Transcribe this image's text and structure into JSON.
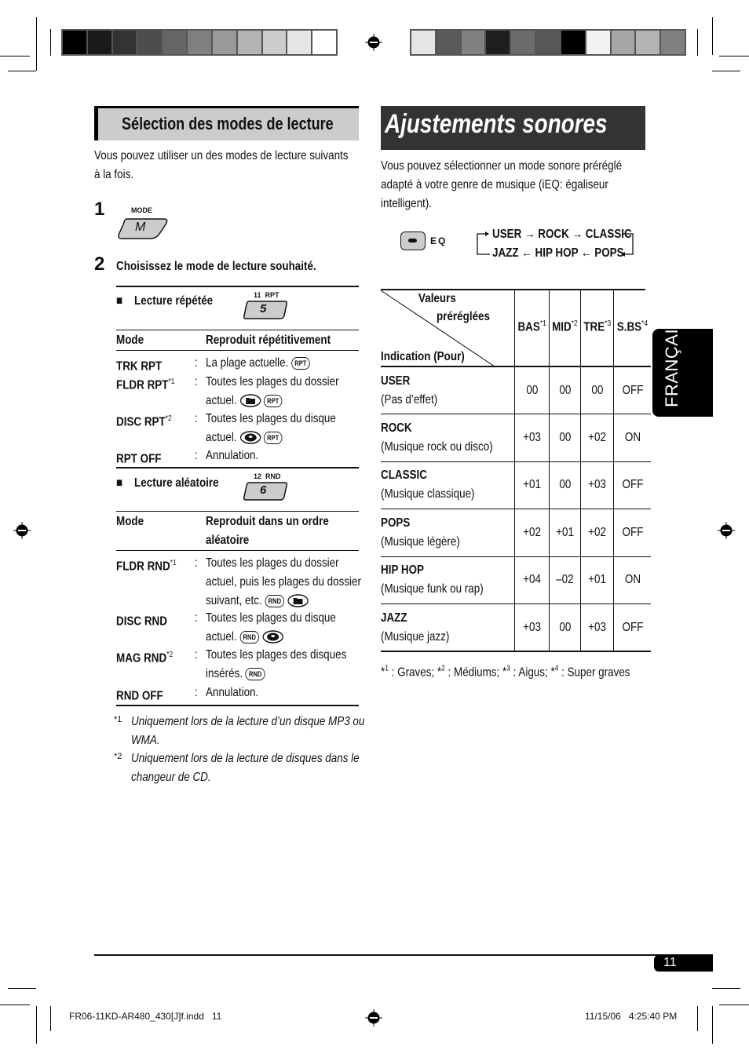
{
  "print_marks": {
    "color_bar_left": [
      "#000000",
      "#1a1a1a",
      "#333333",
      "#4d4d4d",
      "#666666",
      "#808080",
      "#999999",
      "#b3b3b3",
      "#cccccc",
      "#e6e6e6",
      "#ffffff"
    ],
    "color_bar_right": [
      "#e6e6e6",
      "#5a5a5a",
      "#808080",
      "#1e1e1e",
      "#6b6b6b",
      "#575757",
      "#000000",
      "#f2f2f2",
      "#a6a6a6",
      "#b3b3b3",
      "#808080"
    ]
  },
  "left": {
    "heading": "Sélection des modes de lecture",
    "intro_line1": "Vous pouvez utiliser un des modes de lecture suivants",
    "intro_line2": "à la fois.",
    "step1": {
      "number": "1",
      "button_caption": "MODE",
      "button_label": "M"
    },
    "step2": {
      "number": "2",
      "text": "Choisissez le mode de lecture souhaité."
    },
    "repeat": {
      "bullet": "■",
      "title": "Lecture répétée",
      "button_caption": "11  RPT",
      "button_label": "5",
      "col_mode": "Mode",
      "col_desc": "Reproduit répétitivement",
      "rows": [
        {
          "mode": "TRK RPT",
          "note": "",
          "line1": "La plage actuelle.",
          "line2": "",
          "icons": [
            "RPT"
          ]
        },
        {
          "mode": "FLDR RPT",
          "note": "*1",
          "line1": "Toutes les plages du dossier",
          "line2": "actuel.",
          "icons": [
            "folder",
            "RPT"
          ]
        },
        {
          "mode": "DISC RPT",
          "note": "*2",
          "line1": "Toutes les plages du disque",
          "line2": "actuel.",
          "icons": [
            "disc",
            "RPT"
          ]
        },
        {
          "mode": "RPT OFF",
          "note": "",
          "line1": "Annulation.",
          "line2": "",
          "icons": []
        }
      ]
    },
    "random": {
      "bullet": "■",
      "title": "Lecture aléatoire",
      "button_caption": "12  RND",
      "button_label": "6",
      "col_mode": "Mode",
      "col_desc_line1": "Reproduit dans un ordre",
      "col_desc_line2": "aléatoire",
      "rows": [
        {
          "mode": "FLDR RND",
          "note": "*1",
          "line1": "Toutes les plages du dossier",
          "line2": "actuel, puis les plages du dossier",
          "line3": "suivant, etc.",
          "icons": [
            "RND",
            "folder"
          ]
        },
        {
          "mode": "DISC RND",
          "note": "",
          "line1": "Toutes les plages du disque",
          "line2": "actuel.",
          "icons": [
            "RND",
            "disc"
          ]
        },
        {
          "mode": "MAG RND",
          "note": "*2",
          "line1": "Toutes les plages des disques",
          "line2": "insérés.",
          "icons": [
            "RND"
          ]
        },
        {
          "mode": "RND OFF",
          "note": "",
          "line1": "Annulation.",
          "line2": "",
          "icons": []
        }
      ]
    },
    "footnotes": [
      {
        "mark": "*1",
        "line1": "Uniquement lors de la lecture d’un disque MP3 ou",
        "line2": "WMA."
      },
      {
        "mark": "*2",
        "line1": "Uniquement lors de la lecture de disques dans le",
        "line2": "changeur de CD."
      }
    ]
  },
  "right": {
    "heading": "Ajustements sonores",
    "intro_line1": "Vous pouvez sélectionner un mode sonore préréglé",
    "intro_line2": "adapté à votre genre de musique (iEQ: égaliseur",
    "intro_line3": "intelligent).",
    "eq_button_label": "EQ",
    "cycle_top": [
      "USER",
      "ROCK",
      "CLASSIC"
    ],
    "cycle_bottom": [
      "JAZZ",
      "HIP HOP",
      "POPS"
    ],
    "table": {
      "corner_top_line1": "Valeurs",
      "corner_top_line2": "préréglées",
      "corner_bottom": "Indication (Pour)",
      "columns": [
        {
          "label": "BAS",
          "note": "*1"
        },
        {
          "label": "MID",
          "note": "*2"
        },
        {
          "label": "TRE",
          "note": "*3"
        },
        {
          "label": "S.BS",
          "note": "*4"
        }
      ],
      "rows": [
        {
          "name": "USER",
          "desc": "(Pas d’effet)",
          "values": [
            "00",
            "00",
            "00",
            "OFF"
          ]
        },
        {
          "name": "ROCK",
          "desc": "(Musique rock ou disco)",
          "values": [
            "+03",
            "00",
            "+02",
            "ON"
          ]
        },
        {
          "name": "CLASSIC",
          "desc": "(Musique classique)",
          "values": [
            "+01",
            "00",
            "+03",
            "OFF"
          ]
        },
        {
          "name": "POPS",
          "desc": "(Musique légère)",
          "values": [
            "+02",
            "+01",
            "+02",
            "OFF"
          ]
        },
        {
          "name": "HIP HOP",
          "desc": "(Musique funk ou rap)",
          "values": [
            "+04",
            "–02",
            "+01",
            "ON"
          ]
        },
        {
          "name": "JAZZ",
          "desc": "(Musique jazz)",
          "values": [
            "+03",
            "00",
            "+03",
            "OFF"
          ]
        }
      ]
    },
    "footnote": "*1 : Graves; *2 : Médiums; *3 : Aigus; *4 : Super graves"
  },
  "language_tab": "FRANÇAIS",
  "page_number": "11",
  "slug_left": "FR06-11KD-AR480_430[J]f.indd   11",
  "slug_right": "11/15/06   4:25:40 PM"
}
